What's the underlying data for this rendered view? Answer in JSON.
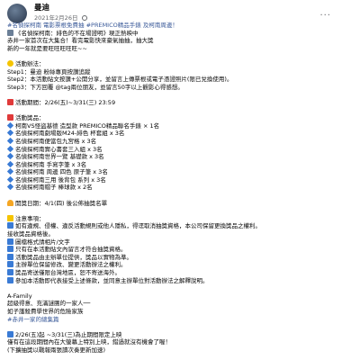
{
  "post": {
    "author": "曼迪",
    "timestamp": "2021年2月26日",
    "lines": [
      {
        "icon": "",
        "text": "#名偵探柯南 電影票根免費抽 #PREMICO精品手錶 及柯南周邊！",
        "cls": "tag"
      },
      {
        "icon": "camera-icon",
        "text": "《名偵探柯南：緋色的不在場證明》現正熱映中"
      },
      {
        "icon": "",
        "text": "赤井一家首次在大集合！看完電影快來豪氣抽抽，抽大獎"
      },
      {
        "icon": "",
        "text": "新的一年就是要旺旺旺旺旺~~"
      },
      {
        "icon": "",
        "text": ""
      },
      {
        "icon": "bulb-icon",
        "text": "活動辦法："
      },
      {
        "icon": "",
        "text": "Step1：曼迪 粉絲專頁按讚追蹤"
      },
      {
        "icon": "",
        "text": "Step2：本活動貼文按讚+公開分享，並留言上傳票根或電子憑證照片(限已兌換使用)。"
      },
      {
        "icon": "",
        "text": "Step3：下方回覆 @tag兩位朋友，並留言50字以上觀影心得感想。"
      },
      {
        "icon": "",
        "text": ""
      },
      {
        "icon": "calendar-icon",
        "text": "活動期間：2/26(五)~3/31(三) 23:59"
      },
      {
        "icon": "",
        "text": ""
      },
      {
        "icon": "gift-icon",
        "text": "活動獎品："
      },
      {
        "icon": "diamond-icon",
        "text": "柯南VS怪盜基德 造型款 PREMICO精品聯名手錶 × 1名"
      },
      {
        "icon": "diamond-icon",
        "text": "名偵探柯南劇場版M24-緋色 杯套組 x 3名"
      },
      {
        "icon": "diamond-icon",
        "text": "名偵探柯南便當包九宮格 x 3名"
      },
      {
        "icon": "diamond-icon",
        "text": "名偵探柯南實心書套三入組 x 3名"
      },
      {
        "icon": "diamond-icon",
        "text": "名偵探柯南世界一覽 基礎款 x 3名"
      },
      {
        "icon": "diamond-icon",
        "text": "名偵探柯南 手寫字筆 x 3名"
      },
      {
        "icon": "diamond-icon",
        "text": "名偵探柯南 周邊 四色 原子筆 x 3名"
      },
      {
        "icon": "diamond-icon",
        "text": "名偵探柯南三用 後背包 系列 x 3名"
      },
      {
        "icon": "diamond-icon",
        "text": "名偵探柯南帽子 棒球款 x 2名"
      },
      {
        "icon": "",
        "text": ""
      },
      {
        "icon": "bell-icon",
        "text": "開獎日期：4/1(四) 後公佈抽獎名單"
      },
      {
        "icon": "",
        "text": ""
      },
      {
        "icon": "warning-icon",
        "text": "注意事項："
      },
      {
        "icon": "point-icon",
        "text": "如有違規、侵權、違反活動規則或他人隱私，得逕取消抽獎資格，本公司保留更換獎品之權利。"
      },
      {
        "icon": "",
        "text": "接收獎品資格後。"
      },
      {
        "icon": "point-icon",
        "text": "圖檔格式請相片/文字"
      },
      {
        "icon": "point-icon",
        "text": "只有在本活動貼文內留言才符合抽獎資格。"
      },
      {
        "icon": "point-icon",
        "text": "活動獎品由主辦單位提供，獎品以實物為準。"
      },
      {
        "icon": "point-icon",
        "text": "主辦單位保留修改、變更活動辦法之權利。"
      },
      {
        "icon": "point-icon",
        "text": "獎品寄送僅限台灣地區，恕不寄送海外。"
      },
      {
        "icon": "point-icon",
        "text": "參加本活動即代表接受上述條款，並同意主辦單位對活動辦法之解釋說明。"
      },
      {
        "icon": "",
        "text": ""
      },
      {
        "icon": "",
        "text": "A-Family"
      },
      {
        "icon": "",
        "text": "超級得意、充滿謎團的一家人──"
      },
      {
        "icon": "",
        "text": "如子護殺費學世界的危險家族"
      },
      {
        "icon": "",
        "text": "#赤井一家的總集篇",
        "cls": "tag"
      },
      {
        "icon": "",
        "text": ""
      },
      {
        "icon": "point-icon",
        "text": "2/26(五)起 ~3/31(三)為止期間限定上映"
      },
      {
        "icon": "",
        "text": "僅有在這段期間內在大螢幕上特別上映，錯過就沒有機會了喔！"
      },
      {
        "icon": "",
        "text": "(下擴抽獎以戰報兩張讀次奏更新加速)"
      }
    ]
  }
}
